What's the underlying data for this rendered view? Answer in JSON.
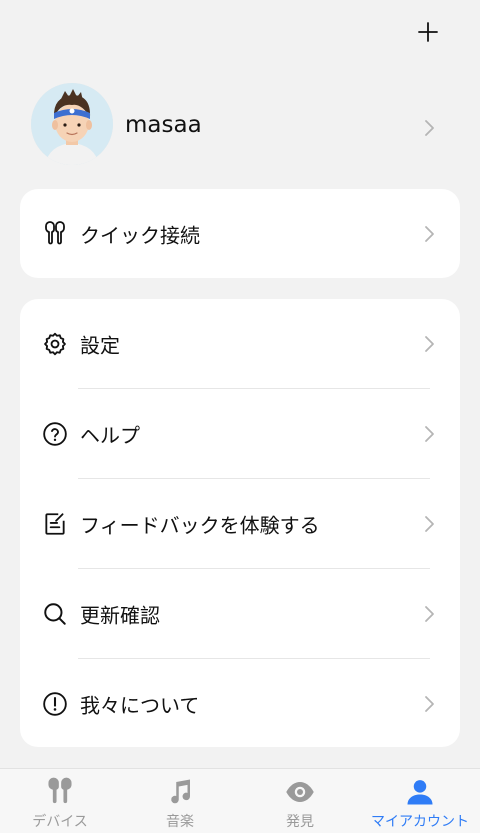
{
  "header": {
    "add_icon": "plus-icon"
  },
  "profile": {
    "name": "masaa",
    "avatar_icon": "avatar"
  },
  "quick_card": {
    "label": "クイック接続",
    "icon": "earbuds-icon"
  },
  "menu": [
    {
      "label": "設定",
      "icon": "gear-icon"
    },
    {
      "label": "ヘルプ",
      "icon": "help-circle-icon"
    },
    {
      "label": "フィードバックを体験する",
      "icon": "feedback-icon"
    },
    {
      "label": "更新確認",
      "icon": "search-icon"
    },
    {
      "label": "我々について",
      "icon": "info-icon"
    }
  ],
  "tabbar": [
    {
      "label": "デバイス",
      "icon": "earbuds-icon",
      "active": false
    },
    {
      "label": "音楽",
      "icon": "music-note-icon",
      "active": false
    },
    {
      "label": "発見",
      "icon": "eye-icon",
      "active": false
    },
    {
      "label": "マイアカウント",
      "icon": "person-icon",
      "active": true
    }
  ],
  "colors": {
    "accent": "#2f7cf6",
    "background": "#f2f2f2",
    "inactive": "#9a9a9a"
  }
}
